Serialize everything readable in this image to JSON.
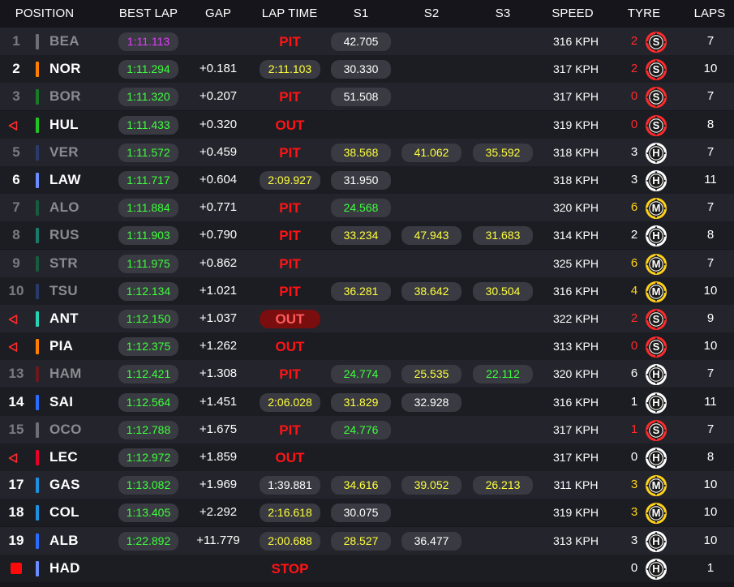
{
  "headers": {
    "position": "POSITION",
    "best_lap": "BEST LAP",
    "gap": "GAP",
    "lap_time": "LAP TIME",
    "s1": "S1",
    "s2": "S2",
    "s3": "S3",
    "speed": "SPEED",
    "tyre": "TYRE",
    "laps": "LAPS"
  },
  "colors": {
    "purple": "#e23bff",
    "green": "#3dff3d",
    "yellow": "#ffff3a",
    "red": "#ff2b2b",
    "soft_tyre": "#ff2b2b",
    "medium_tyre": "#ffd21a",
    "hard_tyre": "#ffffff"
  },
  "rows": [
    {
      "pos": "1",
      "pos_style": "dim",
      "driver": "BEA",
      "driver_style": "dim",
      "team_color": "#6b6f76",
      "best_lap": "1:11.113",
      "best_lap_color": "purple",
      "gap": "",
      "lap_time": "",
      "lap_time_color": "",
      "status": "PIT",
      "status_style": "text",
      "s1": "42.705",
      "s1_color": "white",
      "s2": "",
      "s2_color": "",
      "s3": "",
      "s3_color": "",
      "speed": "316 KPH",
      "tyre_laps": "2",
      "tyre_laps_color": "red",
      "tyre": "S",
      "laps": "7"
    },
    {
      "pos": "2",
      "pos_style": "bright",
      "driver": "NOR",
      "driver_style": "bright",
      "team_color": "#ff8000",
      "best_lap": "1:11.294",
      "best_lap_color": "green",
      "gap": "+0.181",
      "lap_time": "2:11.103",
      "lap_time_color": "yellow",
      "status": "",
      "status_style": "",
      "s1": "30.330",
      "s1_color": "white",
      "s2": "",
      "s2_color": "",
      "s3": "",
      "s3_color": "",
      "speed": "317 KPH",
      "tyre_laps": "2",
      "tyre_laps_color": "red",
      "tyre": "S",
      "laps": "10"
    },
    {
      "pos": "3",
      "pos_style": "dim",
      "driver": "BOR",
      "driver_style": "dim",
      "team_color": "#1a7a2a",
      "best_lap": "1:11.320",
      "best_lap_color": "green",
      "gap": "+0.207",
      "lap_time": "",
      "lap_time_color": "",
      "status": "PIT",
      "status_style": "text",
      "s1": "51.508",
      "s1_color": "white",
      "s2": "",
      "s2_color": "",
      "s3": "",
      "s3_color": "",
      "speed": "317 KPH",
      "tyre_laps": "0",
      "tyre_laps_color": "red",
      "tyre": "S",
      "laps": "7"
    },
    {
      "pos": "",
      "pos_style": "flag",
      "driver": "HUL",
      "driver_style": "bright",
      "team_color": "#21c421",
      "best_lap": "1:11.433",
      "best_lap_color": "green",
      "gap": "+0.320",
      "lap_time": "",
      "lap_time_color": "",
      "status": "OUT",
      "status_style": "text",
      "s1": "",
      "s1_color": "",
      "s2": "",
      "s2_color": "",
      "s3": "",
      "s3_color": "",
      "speed": "319 KPH",
      "tyre_laps": "0",
      "tyre_laps_color": "red",
      "tyre": "S",
      "laps": "8"
    },
    {
      "pos": "5",
      "pos_style": "dim",
      "driver": "VER",
      "driver_style": "dim",
      "team_color": "#2a3a6a",
      "best_lap": "1:11.572",
      "best_lap_color": "green",
      "gap": "+0.459",
      "lap_time": "",
      "lap_time_color": "",
      "status": "PIT",
      "status_style": "text",
      "s1": "38.568",
      "s1_color": "yellow",
      "s2": "41.062",
      "s2_color": "yellow",
      "s3": "35.592",
      "s3_color": "yellow",
      "speed": "318 KPH",
      "tyre_laps": "3",
      "tyre_laps_color": "white",
      "tyre": "H",
      "laps": "7"
    },
    {
      "pos": "6",
      "pos_style": "bright",
      "driver": "LAW",
      "driver_style": "bright",
      "team_color": "#6a8cff",
      "best_lap": "1:11.717",
      "best_lap_color": "green",
      "gap": "+0.604",
      "lap_time": "2:09.927",
      "lap_time_color": "yellow",
      "status": "",
      "status_style": "",
      "s1": "31.950",
      "s1_color": "white",
      "s2": "",
      "s2_color": "",
      "s3": "",
      "s3_color": "",
      "speed": "318 KPH",
      "tyre_laps": "3",
      "tyre_laps_color": "white",
      "tyre": "H",
      "laps": "11"
    },
    {
      "pos": "7",
      "pos_style": "dim",
      "driver": "ALO",
      "driver_style": "dim",
      "team_color": "#1a5a3e",
      "best_lap": "1:11.884",
      "best_lap_color": "green",
      "gap": "+0.771",
      "lap_time": "",
      "lap_time_color": "",
      "status": "PIT",
      "status_style": "text",
      "s1": "24.568",
      "s1_color": "green",
      "s2": "",
      "s2_color": "",
      "s3": "",
      "s3_color": "",
      "speed": "320 KPH",
      "tyre_laps": "6",
      "tyre_laps_color": "amber",
      "tyre": "M",
      "laps": "7"
    },
    {
      "pos": "8",
      "pos_style": "dim",
      "driver": "RUS",
      "driver_style": "dim",
      "team_color": "#1a7a6a",
      "best_lap": "1:11.903",
      "best_lap_color": "green",
      "gap": "+0.790",
      "lap_time": "",
      "lap_time_color": "",
      "status": "PIT",
      "status_style": "text",
      "s1": "33.234",
      "s1_color": "yellow",
      "s2": "47.943",
      "s2_color": "yellow",
      "s3": "31.683",
      "s3_color": "yellow",
      "speed": "314 KPH",
      "tyre_laps": "2",
      "tyre_laps_color": "white",
      "tyre": "H",
      "laps": "8"
    },
    {
      "pos": "9",
      "pos_style": "dim",
      "driver": "STR",
      "driver_style": "dim",
      "team_color": "#1a5a3e",
      "best_lap": "1:11.975",
      "best_lap_color": "green",
      "gap": "+0.862",
      "lap_time": "",
      "lap_time_color": "",
      "status": "PIT",
      "status_style": "text",
      "s1": "",
      "s1_color": "",
      "s2": "",
      "s2_color": "",
      "s3": "",
      "s3_color": "",
      "speed": "325 KPH",
      "tyre_laps": "6",
      "tyre_laps_color": "amber",
      "tyre": "M",
      "laps": "7"
    },
    {
      "pos": "10",
      "pos_style": "dim",
      "driver": "TSU",
      "driver_style": "dim",
      "team_color": "#2a3a6a",
      "best_lap": "1:12.134",
      "best_lap_color": "green",
      "gap": "+1.021",
      "lap_time": "",
      "lap_time_color": "",
      "status": "PIT",
      "status_style": "text",
      "s1": "36.281",
      "s1_color": "yellow",
      "s2": "38.642",
      "s2_color": "yellow",
      "s3": "30.504",
      "s3_color": "yellow",
      "speed": "316 KPH",
      "tyre_laps": "4",
      "tyre_laps_color": "amber",
      "tyre": "M",
      "laps": "10"
    },
    {
      "pos": "",
      "pos_style": "flag",
      "driver": "ANT",
      "driver_style": "bright",
      "team_color": "#27d3b6",
      "best_lap": "1:12.150",
      "best_lap_color": "green",
      "gap": "+1.037",
      "lap_time": "",
      "lap_time_color": "",
      "status": "OUT",
      "status_style": "pill",
      "s1": "",
      "s1_color": "",
      "s2": "",
      "s2_color": "",
      "s3": "",
      "s3_color": "",
      "speed": "322 KPH",
      "tyre_laps": "2",
      "tyre_laps_color": "red",
      "tyre": "S",
      "laps": "9"
    },
    {
      "pos": "",
      "pos_style": "flag",
      "driver": "PIA",
      "driver_style": "bright",
      "team_color": "#ff8000",
      "best_lap": "1:12.375",
      "best_lap_color": "green",
      "gap": "+1.262",
      "lap_time": "",
      "lap_time_color": "",
      "status": "OUT",
      "status_style": "text",
      "s1": "",
      "s1_color": "",
      "s2": "",
      "s2_color": "",
      "s3": "",
      "s3_color": "",
      "speed": "313 KPH",
      "tyre_laps": "0",
      "tyre_laps_color": "red",
      "tyre": "S",
      "laps": "10"
    },
    {
      "pos": "13",
      "pos_style": "dim",
      "driver": "HAM",
      "driver_style": "dim",
      "team_color": "#6a1a1f",
      "best_lap": "1:12.421",
      "best_lap_color": "green",
      "gap": "+1.308",
      "lap_time": "",
      "lap_time_color": "",
      "status": "PIT",
      "status_style": "text",
      "s1": "24.774",
      "s1_color": "green",
      "s2": "25.535",
      "s2_color": "yellow",
      "s3": "22.112",
      "s3_color": "green",
      "speed": "320 KPH",
      "tyre_laps": "6",
      "tyre_laps_color": "white",
      "tyre": "H",
      "laps": "7"
    },
    {
      "pos": "14",
      "pos_style": "bright",
      "driver": "SAI",
      "driver_style": "bright",
      "team_color": "#2a6cff",
      "best_lap": "1:12.564",
      "best_lap_color": "green",
      "gap": "+1.451",
      "lap_time": "2:06.028",
      "lap_time_color": "yellow",
      "status": "",
      "status_style": "",
      "s1": "31.829",
      "s1_color": "yellow",
      "s2": "32.928",
      "s2_color": "white",
      "s3": "",
      "s3_color": "",
      "speed": "316 KPH",
      "tyre_laps": "1",
      "tyre_laps_color": "white",
      "tyre": "H",
      "laps": "11"
    },
    {
      "pos": "15",
      "pos_style": "dim",
      "driver": "OCO",
      "driver_style": "dim",
      "team_color": "#6b6f76",
      "best_lap": "1:12.788",
      "best_lap_color": "green",
      "gap": "+1.675",
      "lap_time": "",
      "lap_time_color": "",
      "status": "PIT",
      "status_style": "text",
      "s1": "24.776",
      "s1_color": "green",
      "s2": "",
      "s2_color": "",
      "s3": "",
      "s3_color": "",
      "speed": "317 KPH",
      "tyre_laps": "1",
      "tyre_laps_color": "red",
      "tyre": "S",
      "laps": "7"
    },
    {
      "pos": "",
      "pos_style": "flag",
      "driver": "LEC",
      "driver_style": "bright",
      "team_color": "#e8002d",
      "best_lap": "1:12.972",
      "best_lap_color": "green",
      "gap": "+1.859",
      "lap_time": "",
      "lap_time_color": "",
      "status": "OUT",
      "status_style": "text",
      "s1": "",
      "s1_color": "",
      "s2": "",
      "s2_color": "",
      "s3": "",
      "s3_color": "",
      "speed": "317 KPH",
      "tyre_laps": "0",
      "tyre_laps_color": "white",
      "tyre": "H",
      "laps": "8"
    },
    {
      "pos": "17",
      "pos_style": "bright",
      "driver": "GAS",
      "driver_style": "bright",
      "team_color": "#1e90e0",
      "best_lap": "1:13.082",
      "best_lap_color": "green",
      "gap": "+1.969",
      "lap_time": "1:39.881",
      "lap_time_color": "white",
      "status": "",
      "status_style": "",
      "s1": "34.616",
      "s1_color": "yellow",
      "s2": "39.052",
      "s2_color": "yellow",
      "s3": "26.213",
      "s3_color": "yellow",
      "speed": "311 KPH",
      "tyre_laps": "3",
      "tyre_laps_color": "amber",
      "tyre": "M",
      "laps": "10"
    },
    {
      "pos": "18",
      "pos_style": "bright",
      "driver": "COL",
      "driver_style": "bright",
      "team_color": "#1e90e0",
      "best_lap": "1:13.405",
      "best_lap_color": "green",
      "gap": "+2.292",
      "lap_time": "2:16.618",
      "lap_time_color": "yellow",
      "status": "",
      "status_style": "",
      "s1": "30.075",
      "s1_color": "white",
      "s2": "",
      "s2_color": "",
      "s3": "",
      "s3_color": "",
      "speed": "319 KPH",
      "tyre_laps": "3",
      "tyre_laps_color": "amber",
      "tyre": "M",
      "laps": "10"
    },
    {
      "pos": "19",
      "pos_style": "bright",
      "driver": "ALB",
      "driver_style": "bright",
      "team_color": "#2a6cff",
      "best_lap": "1:22.892",
      "best_lap_color": "green",
      "gap": "+11.779",
      "lap_time": "2:00.688",
      "lap_time_color": "yellow",
      "status": "",
      "status_style": "",
      "s1": "28.527",
      "s1_color": "yellow",
      "s2": "36.477",
      "s2_color": "white",
      "s3": "",
      "s3_color": "",
      "speed": "313 KPH",
      "tyre_laps": "3",
      "tyre_laps_color": "white",
      "tyre": "H",
      "laps": "10"
    },
    {
      "pos": "",
      "pos_style": "stop",
      "driver": "HAD",
      "driver_style": "bright",
      "team_color": "#6a8cff",
      "best_lap": "",
      "best_lap_color": "",
      "gap": "",
      "lap_time": "",
      "lap_time_color": "",
      "status": "STOP",
      "status_style": "text",
      "s1": "",
      "s1_color": "",
      "s2": "",
      "s2_color": "",
      "s3": "",
      "s3_color": "",
      "speed": "",
      "tyre_laps": "0",
      "tyre_laps_color": "white",
      "tyre": "H",
      "laps": "1"
    }
  ]
}
